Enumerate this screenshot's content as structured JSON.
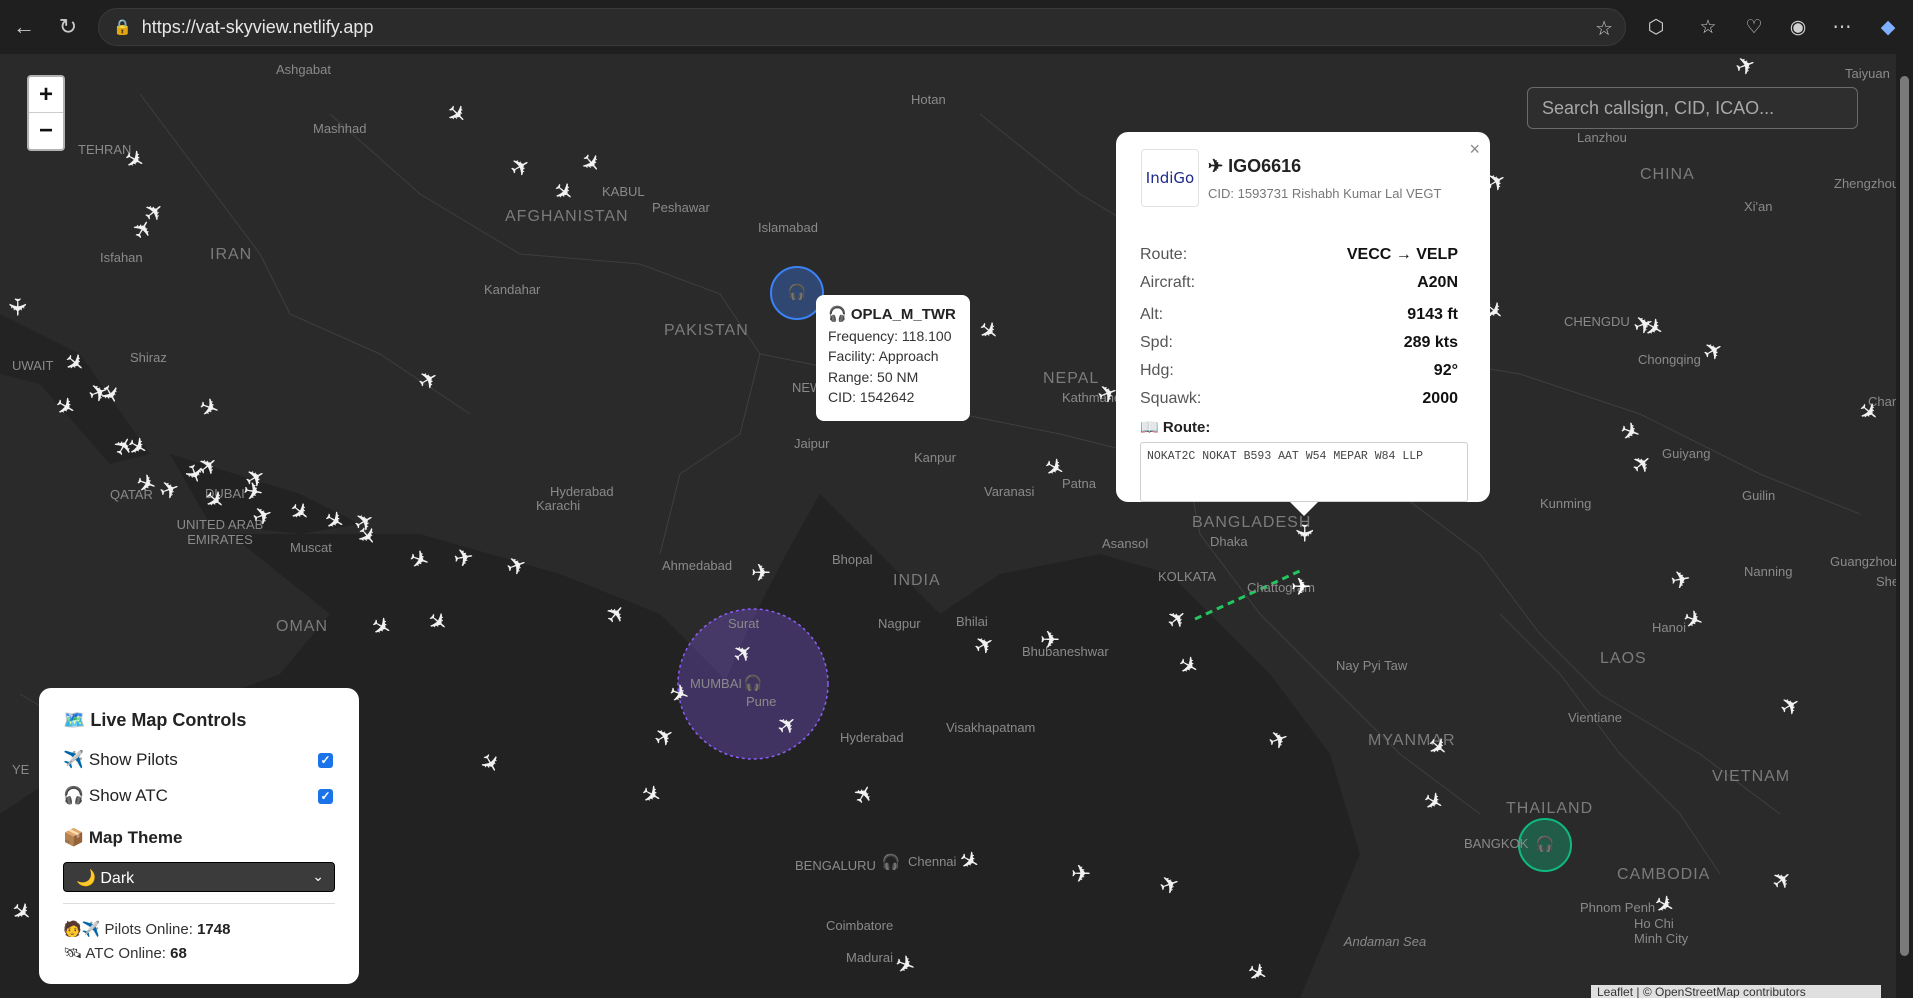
{
  "browser": {
    "url": "https://vat-skyview.netlify.app",
    "back_icon": "back-arrow-icon",
    "reload_icon": "reload-icon"
  },
  "map": {
    "search_placeholder": "Search callsign, CID, ICAO...",
    "zoom_in": "+",
    "zoom_out": "−",
    "attribution": "Leaflet | © OpenStreetMap contributors",
    "labels": [
      {
        "text": "Ashgabat",
        "kind": "city"
      },
      {
        "text": "Mashhad",
        "kind": "city"
      },
      {
        "text": "TEHRAN",
        "kind": "city"
      },
      {
        "text": "Isfahan",
        "kind": "city"
      },
      {
        "text": "IRAN",
        "kind": "country"
      },
      {
        "text": "Shiraz",
        "kind": "city"
      },
      {
        "text": "KABUL",
        "kind": "city"
      },
      {
        "text": "AFGHANISTAN",
        "kind": "country"
      },
      {
        "text": "Peshawar",
        "kind": "city"
      },
      {
        "text": "Islamabad",
        "kind": "city"
      },
      {
        "text": "Kandahar",
        "kind": "city"
      },
      {
        "text": "PAKISTAN",
        "kind": "country"
      },
      {
        "text": "Hotan",
        "kind": "city"
      },
      {
        "text": "Lanzhou",
        "kind": "city"
      },
      {
        "text": "CHINA",
        "kind": "country"
      },
      {
        "text": "Zhengzhou",
        "kind": "city"
      },
      {
        "text": "Xi'an",
        "kind": "city"
      },
      {
        "text": "Taiyuan",
        "kind": "city"
      },
      {
        "text": "UWAIT",
        "kind": "country"
      },
      {
        "text": "QATAR",
        "kind": "country"
      },
      {
        "text": "DUBAI",
        "kind": "city"
      },
      {
        "text": "UNITED ARAB EMIRATES",
        "kind": "country"
      },
      {
        "text": "Muscat",
        "kind": "city"
      },
      {
        "text": "OMAN",
        "kind": "country"
      },
      {
        "text": "YE",
        "kind": "country"
      },
      {
        "text": "Hyderabad",
        "kind": "city"
      },
      {
        "text": "Karachi",
        "kind": "city"
      },
      {
        "text": "Ahmedabad",
        "kind": "city"
      },
      {
        "text": "Jaipur",
        "kind": "city"
      },
      {
        "text": "NEW",
        "kind": "city"
      },
      {
        "text": "Kanpur",
        "kind": "city"
      },
      {
        "text": "NEPAL",
        "kind": "country"
      },
      {
        "text": "Kathmandu",
        "kind": "city"
      },
      {
        "text": "Varanasi",
        "kind": "city"
      },
      {
        "text": "Patna",
        "kind": "city"
      },
      {
        "text": "Bhopal",
        "kind": "city"
      },
      {
        "text": "INDIA",
        "kind": "country"
      },
      {
        "text": "Surat",
        "kind": "city"
      },
      {
        "text": "MUMBAI",
        "kind": "city"
      },
      {
        "text": "Pune",
        "kind": "city"
      },
      {
        "text": "Nagpur",
        "kind": "city"
      },
      {
        "text": "Bhilai",
        "kind": "city"
      },
      {
        "text": "Bhubaneshwar",
        "kind": "city"
      },
      {
        "text": "Asansol",
        "kind": "city"
      },
      {
        "text": "KOLKATA",
        "kind": "city"
      },
      {
        "text": "BANGLADESH",
        "kind": "country"
      },
      {
        "text": "Dhaka",
        "kind": "city"
      },
      {
        "text": "Chattogram",
        "kind": "city"
      },
      {
        "text": "Hyderabad",
        "kind": "city"
      },
      {
        "text": "Visakhapatnam",
        "kind": "city"
      },
      {
        "text": "BENGALURU",
        "kind": "city"
      },
      {
        "text": "Chennai",
        "kind": "city"
      },
      {
        "text": "Coimbatore",
        "kind": "city"
      },
      {
        "text": "Madurai",
        "kind": "city"
      },
      {
        "text": "Nay Pyi Taw",
        "kind": "city"
      },
      {
        "text": "MYANMAR",
        "kind": "country"
      },
      {
        "text": "CHENGDU",
        "kind": "city"
      },
      {
        "text": "Chongqing",
        "kind": "city"
      },
      {
        "text": "Guiyang",
        "kind": "city"
      },
      {
        "text": "Kunming",
        "kind": "city"
      },
      {
        "text": "Guilin",
        "kind": "city"
      },
      {
        "text": "Nanning",
        "kind": "city"
      },
      {
        "text": "Hanoi",
        "kind": "city"
      },
      {
        "text": "LAOS",
        "kind": "country"
      },
      {
        "text": "Vientiane",
        "kind": "city"
      },
      {
        "text": "THAILAND",
        "kind": "country"
      },
      {
        "text": "BANGKOK",
        "kind": "city"
      },
      {
        "text": "VIETNAM",
        "kind": "country"
      },
      {
        "text": "CAMBODIA",
        "kind": "country"
      },
      {
        "text": "Phnom Penh",
        "kind": "city"
      },
      {
        "text": "Ho Chi Minh City",
        "kind": "city"
      },
      {
        "text": "Andaman Sea",
        "kind": "sea"
      },
      {
        "text": "Guangzhou",
        "kind": "city"
      },
      {
        "text": "Shenzhen",
        "kind": "city"
      },
      {
        "text": "Changsha",
        "kind": "city"
      }
    ]
  },
  "atc_popup": {
    "callsign": "OPLA_M_TWR",
    "frequency": "Frequency: 118.100",
    "facility": "Facility: Approach",
    "range": "Range: 50 NM",
    "cid": "CID: 1542642"
  },
  "flight_popup": {
    "logo_text": "IndiGo",
    "callsign": "✈ IGO6616",
    "cid_line": "CID: 1593731 Rishabh Kumar Lal VEGT",
    "route_k": "Route:",
    "route_v": "VECC → VELP",
    "aircraft_k": "Aircraft:",
    "aircraft_v": "A20N",
    "alt_k": "Alt:",
    "alt_v": "9143 ft",
    "spd_k": "Spd:",
    "spd_v": "289 kts",
    "hdg_k": "Hdg:",
    "hdg_v": "92°",
    "squawk_k": "Squawk:",
    "squawk_v": "2000",
    "route_label": "📖 Route:",
    "route_text": "NOKAT2C NOKAT B593 AAT W54 MEPAR W84 LLP",
    "close": "×"
  },
  "controls": {
    "title": "🗺️ Live Map Controls",
    "show_pilots": "✈️ Show Pilots",
    "show_atc": "🎧 Show ATC",
    "theme_title": "📦 Map Theme",
    "theme_value": "🌙 Dark",
    "pilots_label": "🧑✈️ Pilots Online:",
    "pilots_count": "1748",
    "atc_label": "🛰 ATC Online:",
    "atc_count": "68"
  },
  "colors": {
    "map_bg": "#262626",
    "land": "#2d2d2d",
    "water": "#1e1e1e",
    "atc_blue": "#3b82f6",
    "atc_purple": "#8b5cf6",
    "atc_green": "#10b981",
    "route_line": "#22c55e"
  }
}
